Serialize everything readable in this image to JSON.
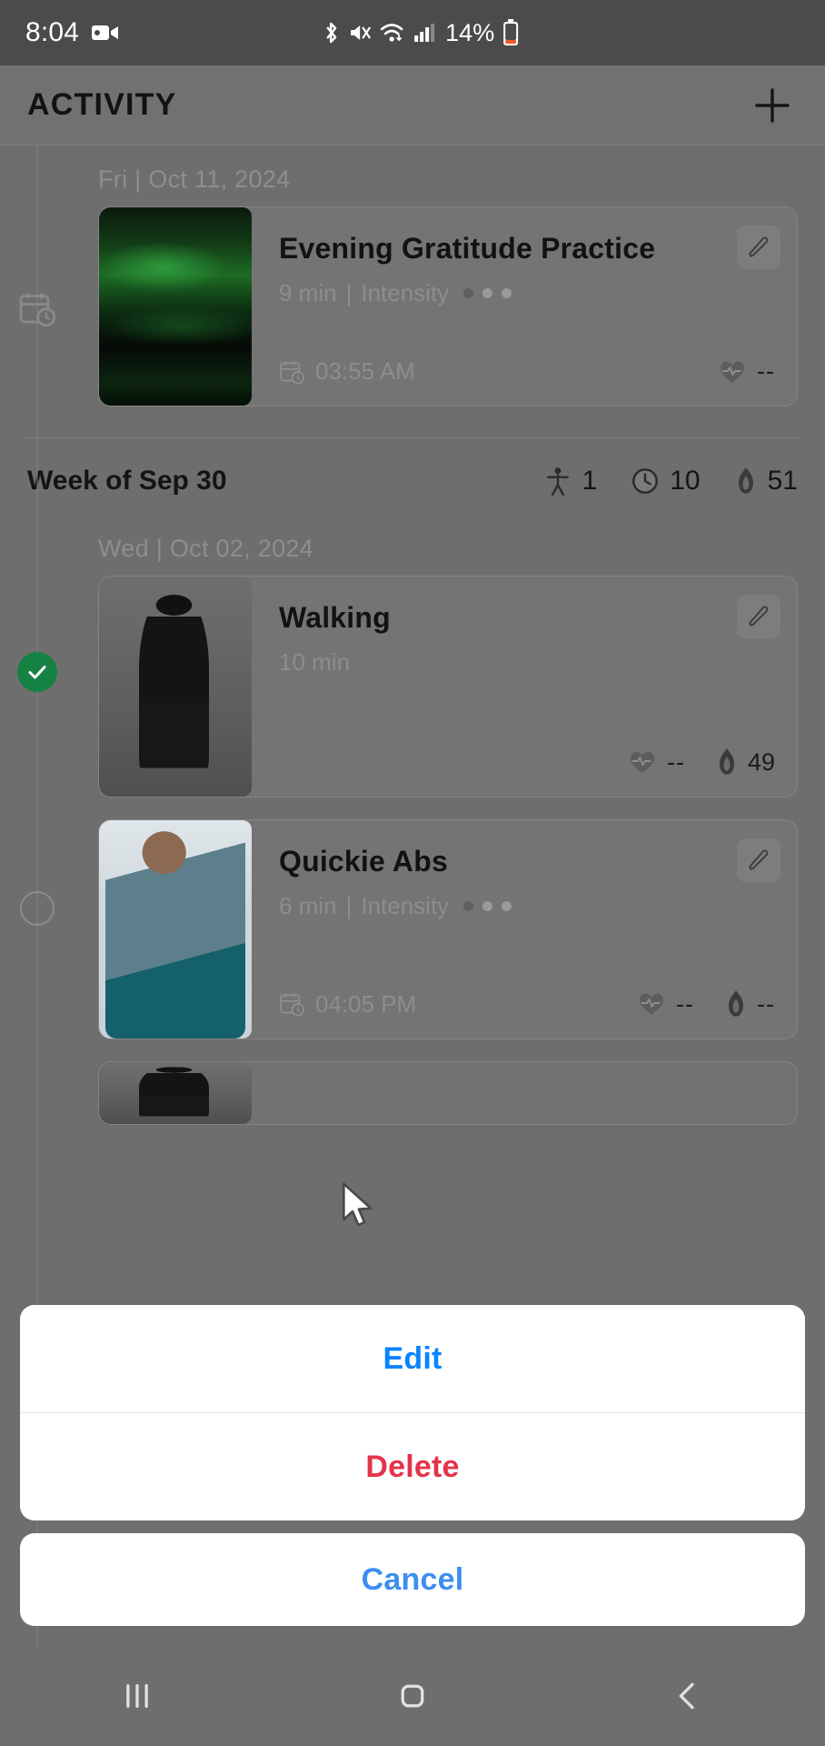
{
  "status_bar": {
    "time": "8:04",
    "battery_percent": "14%",
    "icons": [
      "video-recording-icon",
      "bluetooth-icon",
      "mute-vibrate-icon",
      "wifi-icon",
      "cellular-signal-icon",
      "battery-icon"
    ]
  },
  "header": {
    "title": "ACTIVITY",
    "add_label": "+"
  },
  "groups": [
    {
      "date_label": "Fri | Oct 11, 2024",
      "rail": "calendar-clock-icon",
      "cards": [
        {
          "title": "Evening Gratitude Practice",
          "duration": "9 min",
          "separator": "|",
          "intensity_label": "Intensity",
          "intensity_filled": 1,
          "intensity_total": 3,
          "time": "03:55 AM",
          "heart_value": "--",
          "calories_value": "",
          "thumb": "aurora-image",
          "edit_icon": "pencil-icon"
        }
      ]
    },
    {
      "date_label": "Wed | Oct 02, 2024",
      "rail": "check-circle-icon",
      "cards": [
        {
          "title": "Walking",
          "duration": "10 min",
          "separator": "",
          "intensity_label": "",
          "intensity_filled": 0,
          "intensity_total": 0,
          "time": "",
          "heart_value": "--",
          "calories_value": "49",
          "thumb": "walking-person-image",
          "edit_icon": "pencil-icon"
        },
        {
          "title": "Quickie Abs",
          "duration": "6 min",
          "separator": "|",
          "intensity_label": "Intensity",
          "intensity_filled": 1,
          "intensity_total": 3,
          "time": "04:05 PM",
          "heart_value": "--",
          "calories_value": "--",
          "thumb": "abs-workout-image",
          "edit_icon": "pencil-icon"
        }
      ]
    }
  ],
  "week_summary": {
    "title": "Week of Sep 30",
    "workouts": "1",
    "minutes": "10",
    "calories": "51"
  },
  "action_sheet": {
    "edit_label": "Edit",
    "delete_label": "Delete",
    "cancel_label": "Cancel",
    "edit_color": "#0a84ff",
    "delete_color": "#e4334a",
    "cancel_color": "#3d8ef0"
  },
  "nav_bar": {
    "recents": "recents-icon",
    "home": "home-icon",
    "back": "back-icon"
  }
}
